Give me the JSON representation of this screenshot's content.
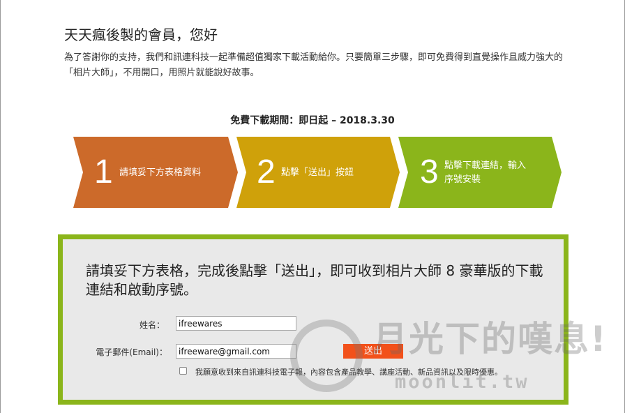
{
  "header": {
    "title": "天天瘋後製的會員，您好",
    "intro": "為了答謝你的支持，我們和訊連科技一起準備超值獨家下載活動給你。只要簡單三步驟，即可免費得到直覺操作且威力強大的「相片大師」，不用開口，用照片就能說好故事。"
  },
  "period": "免費下載期間：即日起 – 2018.3.30",
  "steps": [
    {
      "num": "1",
      "text": "請填妥下方表格資料",
      "color": "#cc6a2a"
    },
    {
      "num": "2",
      "text": "點擊「送出」按鈕",
      "color": "#cfa10a"
    },
    {
      "num": "3",
      "text_line1": "點擊下載連結，輸入",
      "text_line2": "序號安裝",
      "color": "#8bb51b"
    }
  ],
  "form": {
    "heading": "請填妥下方表格，完成後點擊「送出」，即可收到相片大師 8 豪華版的下載連結和啟動序號。",
    "name_label": "姓名：",
    "name_value": "ifreewares",
    "email_label": "電子郵件(Email)：",
    "email_value": "ifreeware@gmail.com",
    "submit_label": "送出",
    "consent_label": "我願意收到來自訊連科技電子報，內容包含產品教學、講座活動、新品資訊以及限時優惠。",
    "border_color": "#8bb51b",
    "submit_color": "#f2511b"
  },
  "watermark": {
    "text": "月光下的嘆息!",
    "url": "moonlit.tw",
    "icon": "moon-logo-icon"
  }
}
